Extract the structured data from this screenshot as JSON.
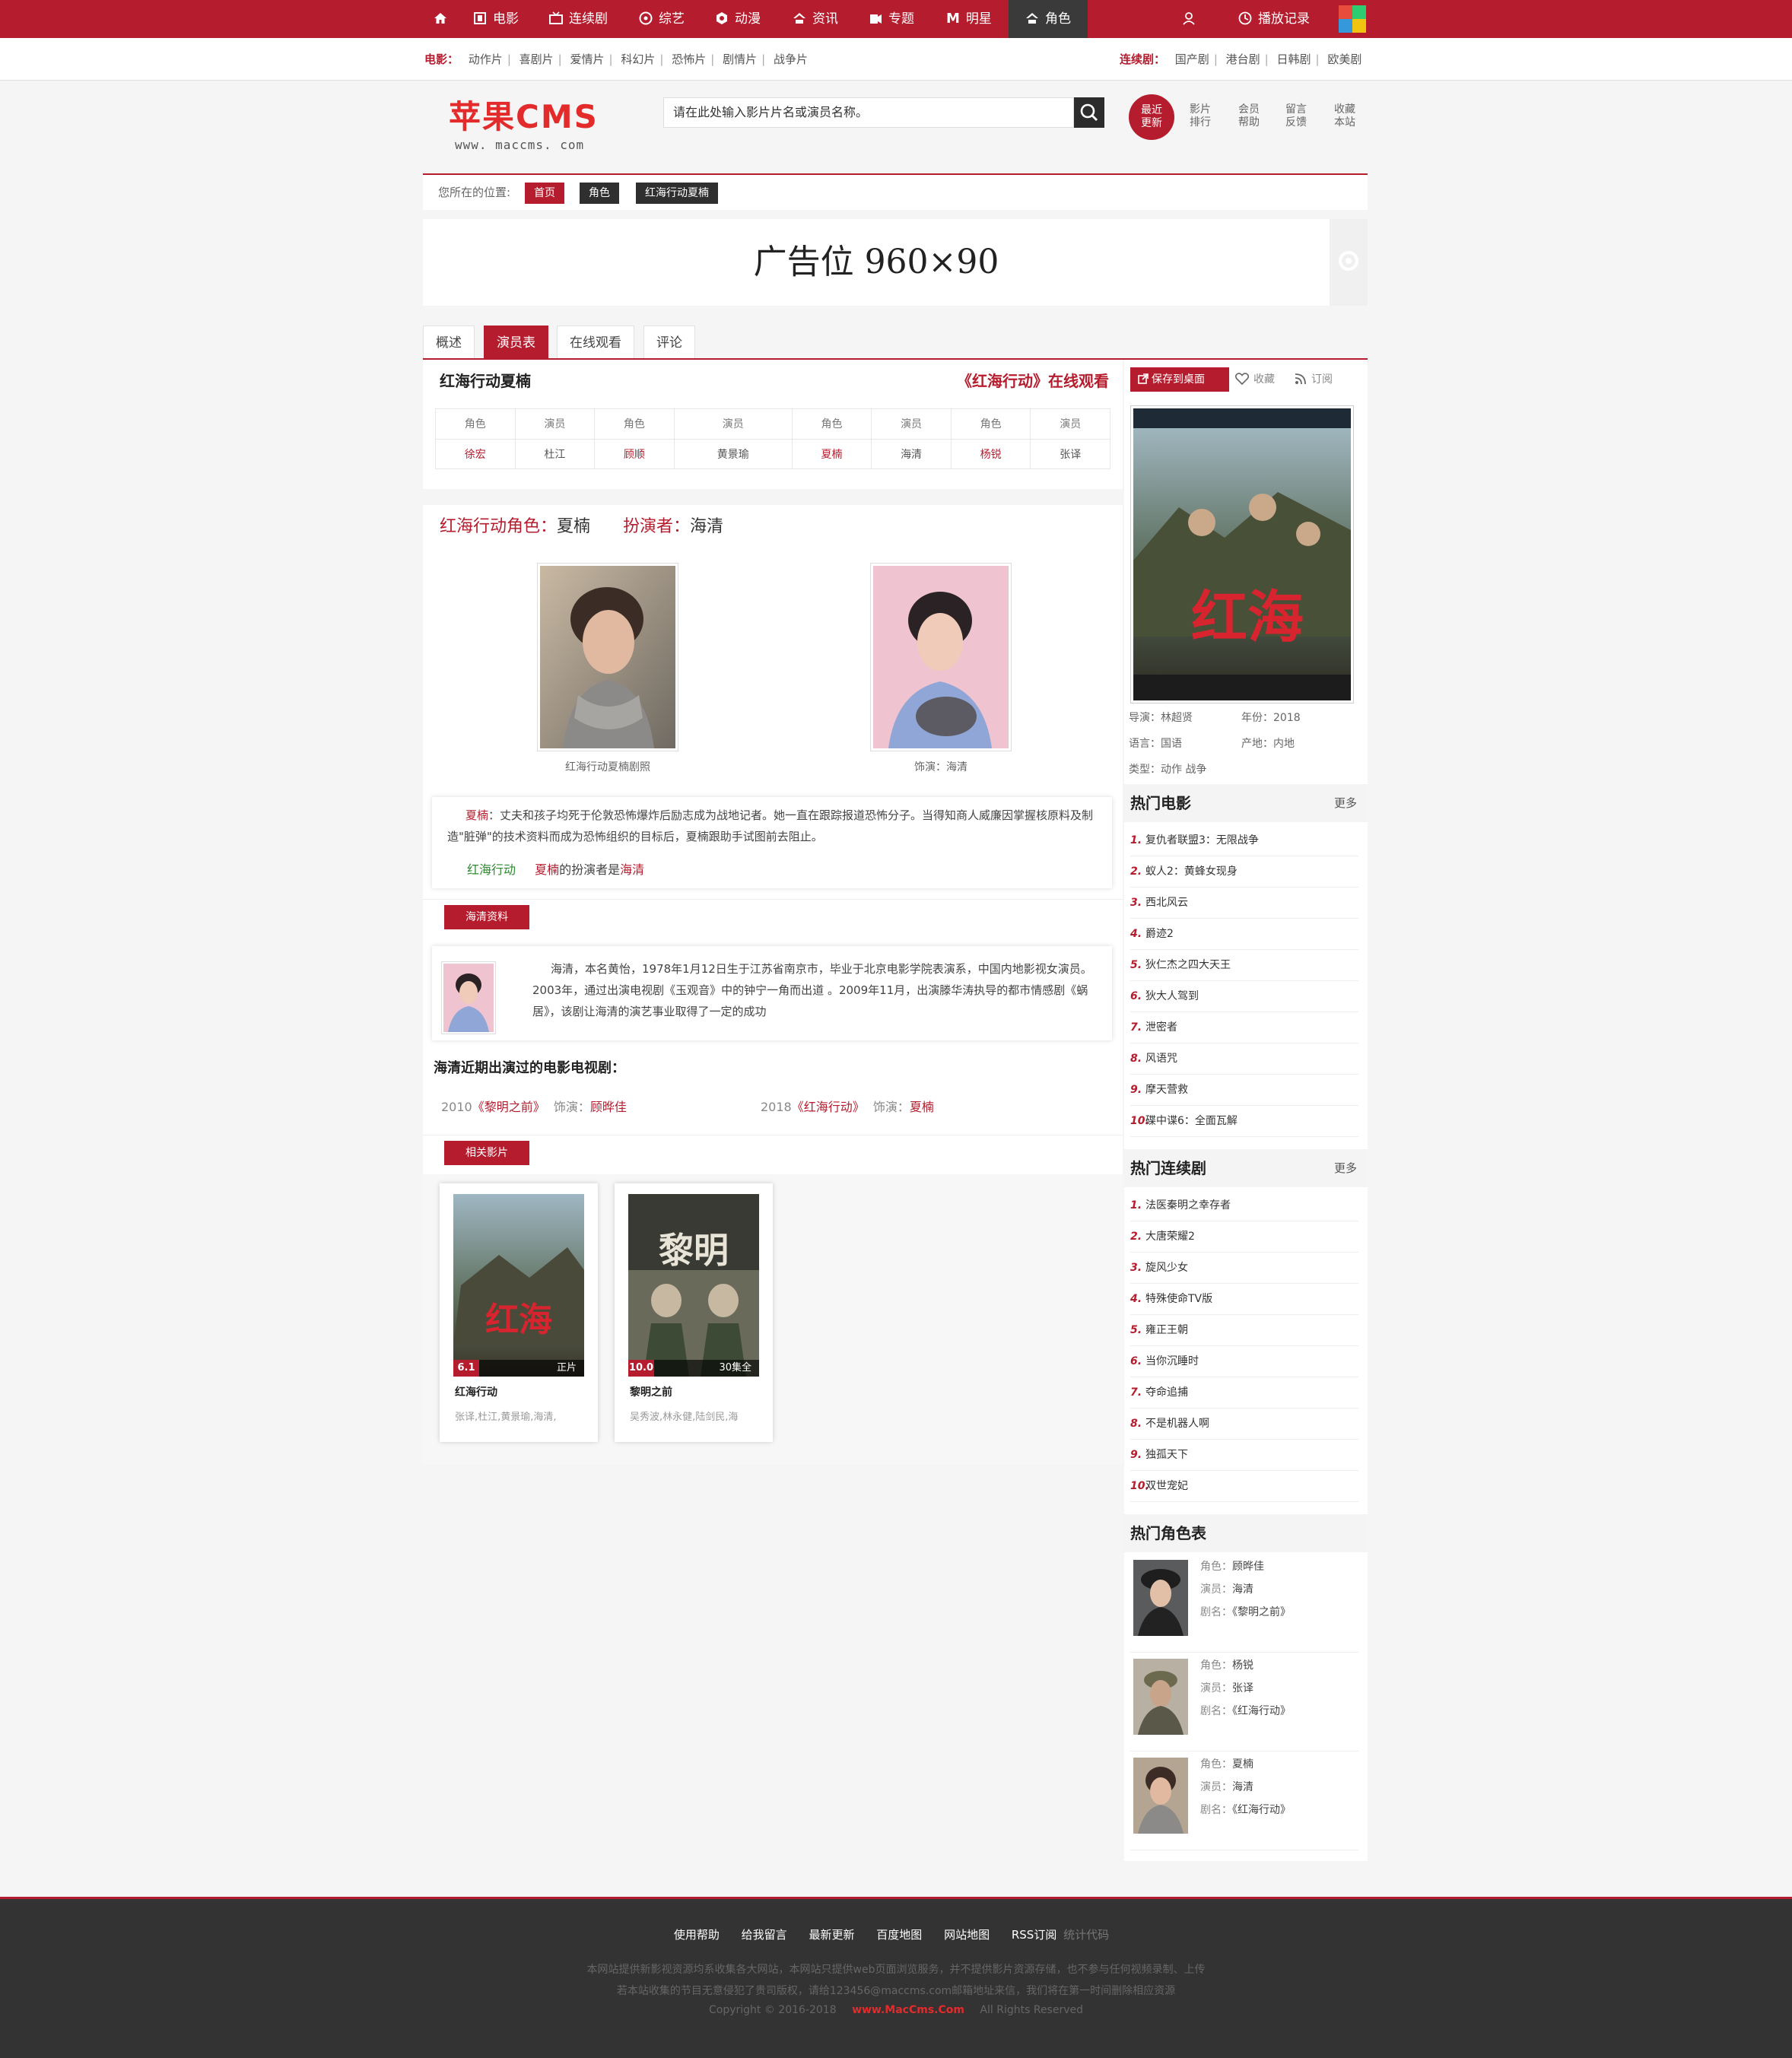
{
  "nav": {
    "items": [
      {
        "label": "电影",
        "icon": "home-icon"
      },
      {
        "label": "电影",
        "icon": "film-icon"
      },
      {
        "label": "连续剧",
        "icon": "tv-icon"
      },
      {
        "label": "综艺",
        "icon": "disc-icon"
      },
      {
        "label": "动漫",
        "icon": "anime-icon"
      },
      {
        "label": "资讯",
        "icon": "news-icon"
      },
      {
        "label": "专题",
        "icon": "topic-icon"
      },
      {
        "label": "明星",
        "icon": "star-m-icon"
      },
      {
        "label": "角色",
        "icon": "role-icon"
      }
    ],
    "history_label": "播放记录"
  },
  "subnav": {
    "movie_label": "电影：",
    "movie_links": [
      "动作片",
      "喜剧片",
      "爱情片",
      "科幻片",
      "恐怖片",
      "剧情片",
      "战争片"
    ],
    "series_label": "连续剧：",
    "series_links": [
      "国产剧",
      "港台剧",
      "日韩剧",
      "欧美剧"
    ]
  },
  "header": {
    "logo_main": "苹果CMS",
    "logo_sub": "www. maccms. com",
    "search_placeholder": "请在此处输入影片片名或演员名称。",
    "recent_line1": "最近",
    "recent_line2": "更新",
    "links": [
      {
        "l1": "影片",
        "l2": "排行"
      },
      {
        "l1": "会员",
        "l2": "帮助"
      },
      {
        "l1": "留言",
        "l2": "反馈"
      },
      {
        "l1": "收藏",
        "l2": "本站"
      }
    ]
  },
  "breadcrumb": {
    "label": "您所在的位置:",
    "items": [
      "首页",
      "角色",
      "红海行动夏楠"
    ]
  },
  "ad": {
    "text": "广告位  960×90"
  },
  "tabs": [
    "概述",
    "演员表",
    "在线观看",
    "评论"
  ],
  "cast": {
    "title": "红海行动夏楠",
    "watch_link": "《红海行动》在线观看",
    "header": [
      "角色",
      "演员",
      "角色",
      "演员",
      "角色",
      "演员",
      "角色",
      "演员"
    ],
    "row": [
      {
        "role": "徐宏",
        "actor": "杜江"
      },
      {
        "role": "顾顺",
        "actor": "黄景瑜"
      },
      {
        "role": "夏楠",
        "actor": "海清"
      },
      {
        "role": "杨锐",
        "actor": "张译"
      }
    ]
  },
  "role": {
    "heading_label": "红海行动角色：",
    "heading_role": "夏楠",
    "heading_actor_label": "扮演者：",
    "heading_actor": "海清",
    "photo1_caption": "红海行动夏楠剧照",
    "photo2_caption": "饰演：海清",
    "desc_name": "夏楠",
    "desc_text": "：丈夫和孩子均死于伦敦恐怖爆炸后励志成为战地记者。她一直在跟踪报道恐怖分子。当得知商人威廉因掌握核原料及制造\"脏弹\"的技术资料而成为恐怖组织的目标后，夏楠跟助手试图前去阻止。",
    "footer_movie": "红海行动",
    "footer_role": "夏楠",
    "footer_mid": "的扮演者是",
    "footer_actor": "海清"
  },
  "actor": {
    "section_tag": "海清资料",
    "bio": "海清，本名黄怡，1978年1月12日生于江苏省南京市，毕业于北京电影学院表演系，中国内地影视女演员。2003年，通过出演电视剧《玉观音》中的钟宁一角而出道 。2009年11月，出演滕华涛执导的都市情感剧《蜗居》，该剧让海清的演艺事业取得了一定的成功",
    "recent_title": "海清近期出演过的电影电视剧：",
    "works": [
      {
        "year": "2010",
        "title": "《黎明之前》",
        "role_label": "饰演：",
        "role": "顾晔佳"
      },
      {
        "year": "2018",
        "title": "《红海行动》",
        "role_label": "饰演：",
        "role": "夏楠"
      }
    ]
  },
  "related": {
    "section_tag": "相关影片",
    "items": [
      {
        "score": "6.1",
        "status": "正片",
        "title": "红海行动",
        "actors": "张译,杜江,黄景瑜,海清,"
      },
      {
        "score": "10.0",
        "status": "30集全",
        "title": "黎明之前",
        "actors": "吴秀波,林永健,陆剑民,海"
      }
    ]
  },
  "side": {
    "save_desktop": "保存到桌面",
    "favorite": "收藏",
    "subscribe": "订阅",
    "info": {
      "director": "导演：林超贤",
      "year": "年份：2018",
      "lang": "语言：国语",
      "area": "产地：内地",
      "type": "类型：动作  战争"
    },
    "hot_movies_title": "热门电影",
    "more": "更多",
    "hot_movies": [
      "复仇者联盟3：无限战争",
      "蚁人2：黄蜂女现身",
      "西北风云",
      "爵迹2",
      "狄仁杰之四大天王",
      "狄大人驾到",
      "泄密者",
      "风语咒",
      "摩天营救",
      "碟中谍6：全面瓦解"
    ],
    "hot_series_title": "热门连续剧",
    "hot_series": [
      "法医秦明之幸存者",
      "大唐荣耀2",
      "旋风少女",
      "特殊使命TV版",
      "雍正王朝",
      "当你沉睡时",
      "夺命追捕",
      "不是机器人啊",
      "独孤天下",
      "双世宠妃"
    ],
    "hot_roles_title": "热门角色表",
    "role_label": "角色：",
    "actor_label": "演员：",
    "drama_label": "剧名：",
    "hot_roles": [
      {
        "role": "顾晔佳",
        "actor": "海清",
        "drama": "《黎明之前》"
      },
      {
        "role": "杨锐",
        "actor": "张译",
        "drama": "《红海行动》"
      },
      {
        "role": "夏楠",
        "actor": "海清",
        "drama": "《红海行动》"
      }
    ]
  },
  "footer": {
    "links": [
      "使用帮助",
      "给我留言",
      "最新更新",
      "百度地图",
      "网站地图",
      "RSS订阅"
    ],
    "stat": "统计代码",
    "line1": "本网站提供新影视资源均系收集各大网站，本网站只提供web页面浏览服务，并不提供影片资源存储，也不参与任何视频录制、上传",
    "line2": "若本站收集的节目无意侵犯了贵司版权，请给123456@maccms.com邮箱地址来信，我们将在第一时间删除相应资源",
    "copyright": "Copyright © 2016-2018",
    "brand": "www.MacCms.Com",
    "rights": "All Rights Reserved"
  },
  "colors": {
    "brand": "#b51d2e",
    "dark": "#333333"
  }
}
